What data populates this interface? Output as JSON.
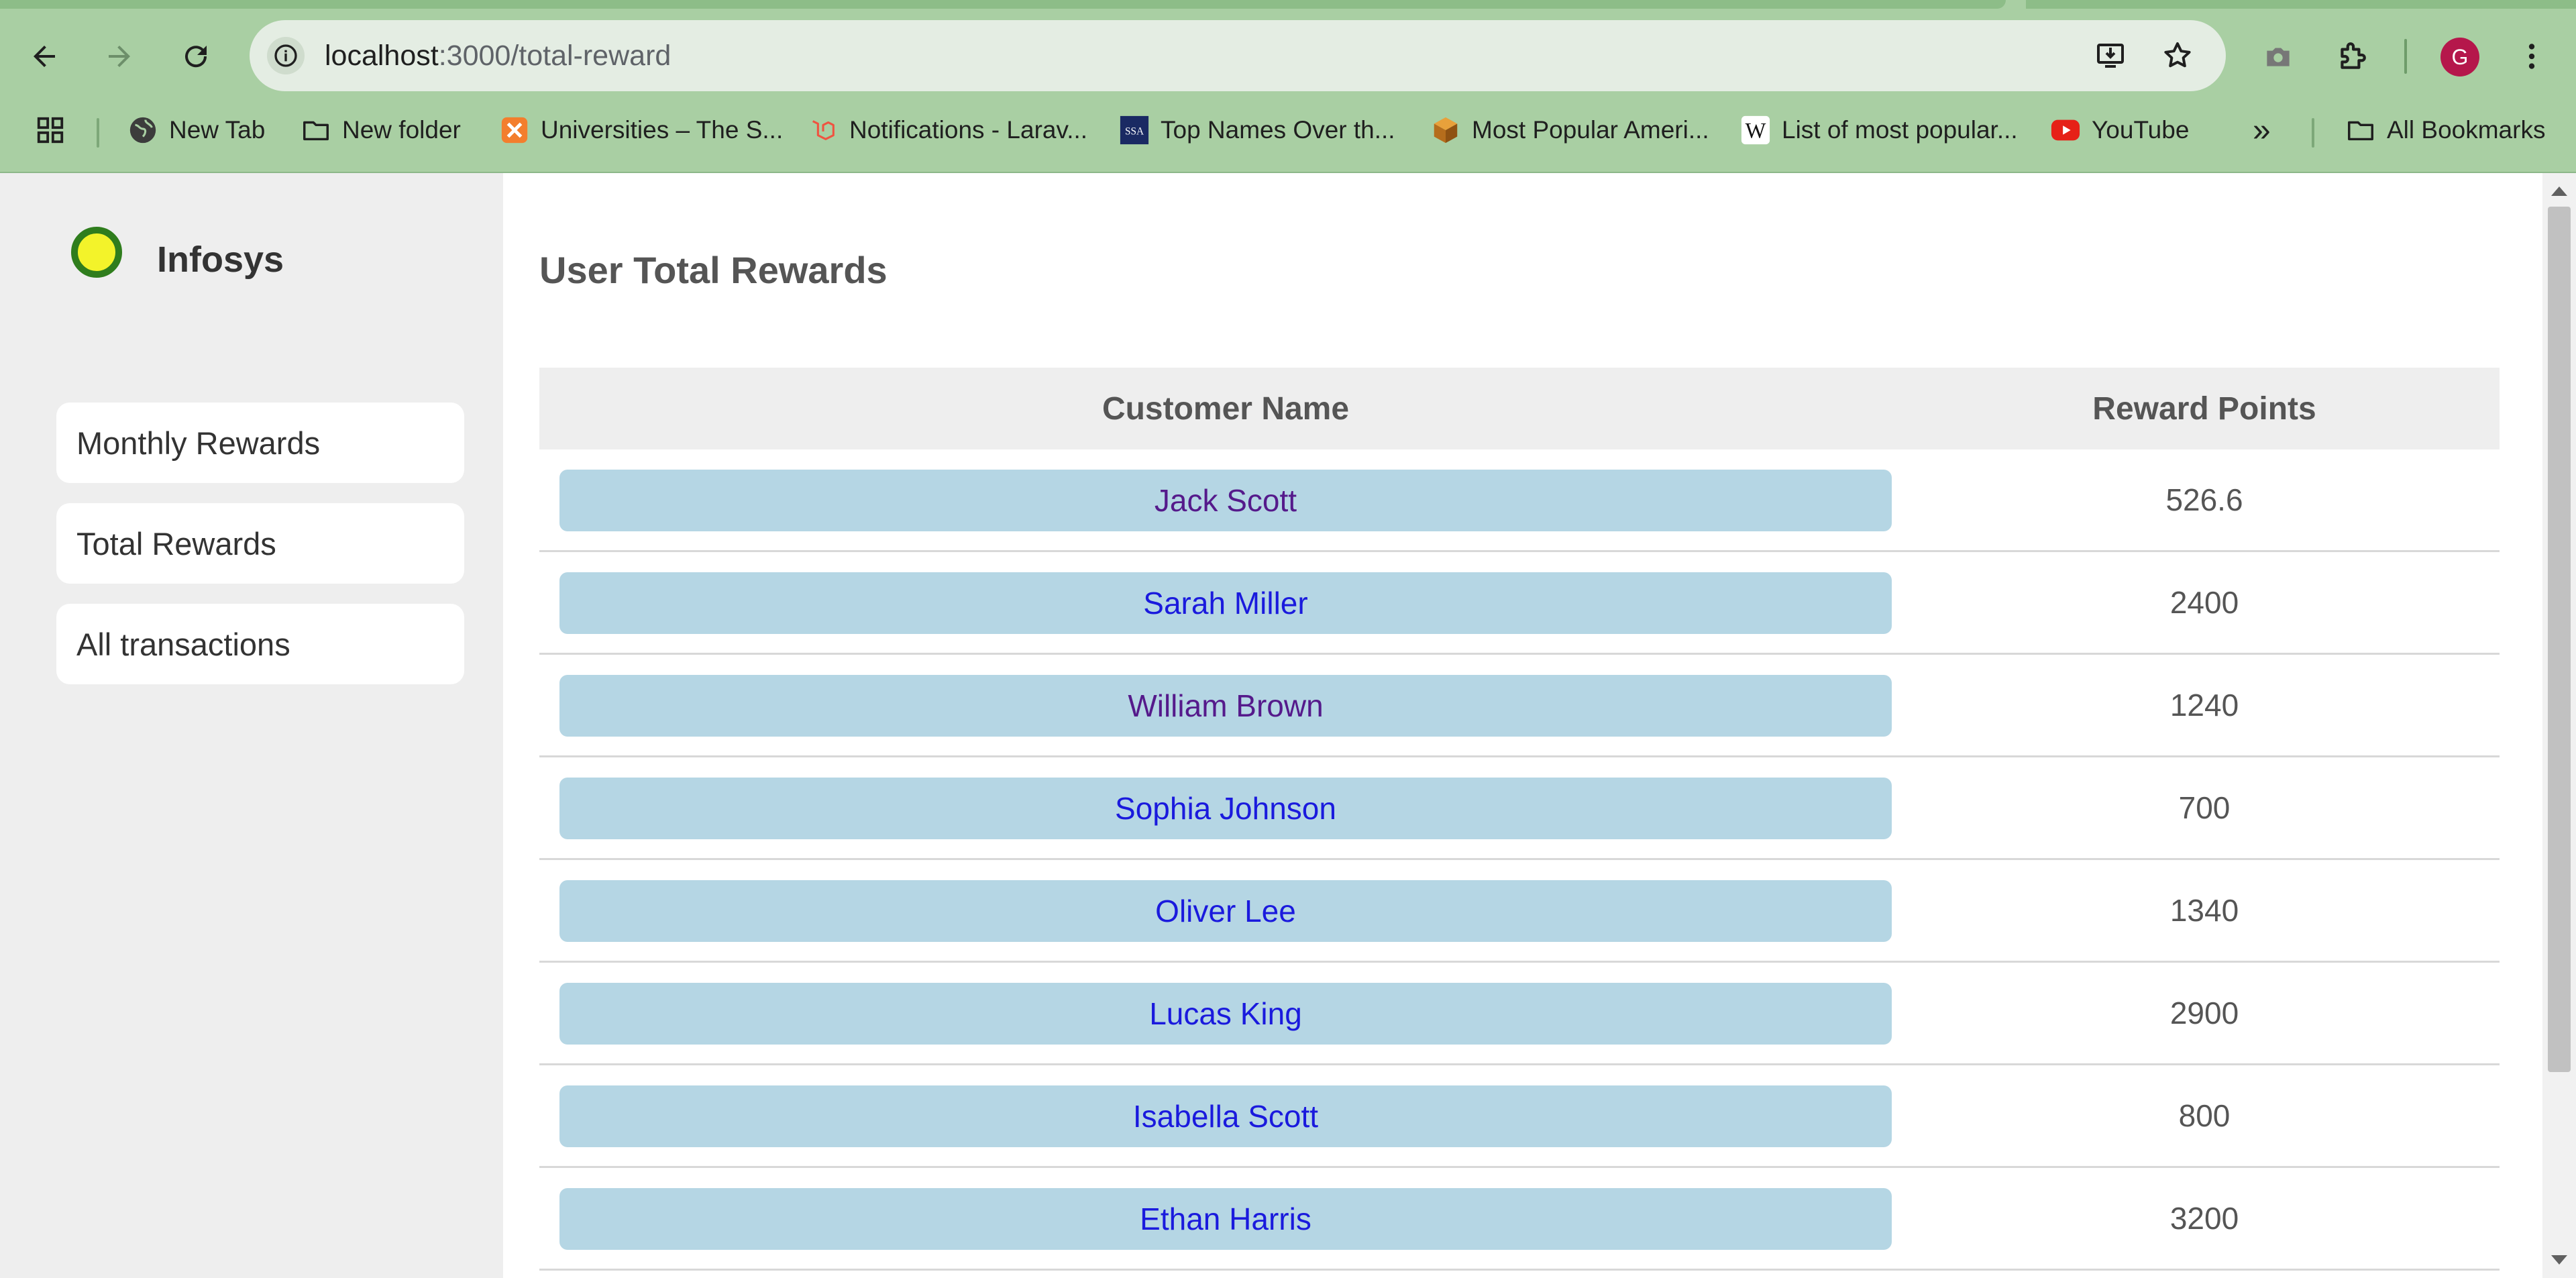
{
  "browser": {
    "url_host": "localhost",
    "url_path": ":3000/total-reward",
    "profile_initial": "G",
    "bookmarks": [
      {
        "label": "New Tab",
        "icon": "globe-icon"
      },
      {
        "label": "New folder",
        "icon": "folder-icon"
      },
      {
        "label": "Universities – The S...",
        "icon": "xampp-icon"
      },
      {
        "label": "Notifications - Larav...",
        "icon": "laravel-icon"
      },
      {
        "label": "Top Names Over th...",
        "icon": "ssa-icon"
      },
      {
        "label": "Most Popular Ameri...",
        "icon": "box-icon"
      },
      {
        "label": "List of most popular...",
        "icon": "wikipedia-icon"
      },
      {
        "label": "YouTube",
        "icon": "youtube-icon"
      }
    ],
    "overflow_label": "»",
    "all_bookmarks_label": "All Bookmarks",
    "ssa_badge": "SSA",
    "wiki_badge": "W"
  },
  "app": {
    "brand": "Infosys",
    "nav": [
      {
        "label": "Monthly Rewards"
      },
      {
        "label": "Total Rewards"
      },
      {
        "label": "All transactions"
      }
    ],
    "page_title": "User Total Rewards",
    "table": {
      "headers": [
        "Customer Name",
        "Reward Points"
      ],
      "rows": [
        {
          "name": "Jack Scott",
          "points": "526.6"
        },
        {
          "name": "Sarah Miller",
          "points": "2400"
        },
        {
          "name": "William Brown",
          "points": "1240"
        },
        {
          "name": "Sophia Johnson",
          "points": "700"
        },
        {
          "name": "Oliver Lee",
          "points": "1340"
        },
        {
          "name": "Lucas King",
          "points": "2900"
        },
        {
          "name": "Isabella Scott",
          "points": "800"
        },
        {
          "name": "Ethan Harris",
          "points": "3200"
        }
      ]
    }
  },
  "colors": {
    "chrome": "#a9cfa3",
    "link": "#1a1add",
    "visited_link": "#551a8b",
    "name_button_bg": "#b5d6e4",
    "logo_fill": "#f3f32a",
    "logo_ring": "#2f7d1d"
  }
}
